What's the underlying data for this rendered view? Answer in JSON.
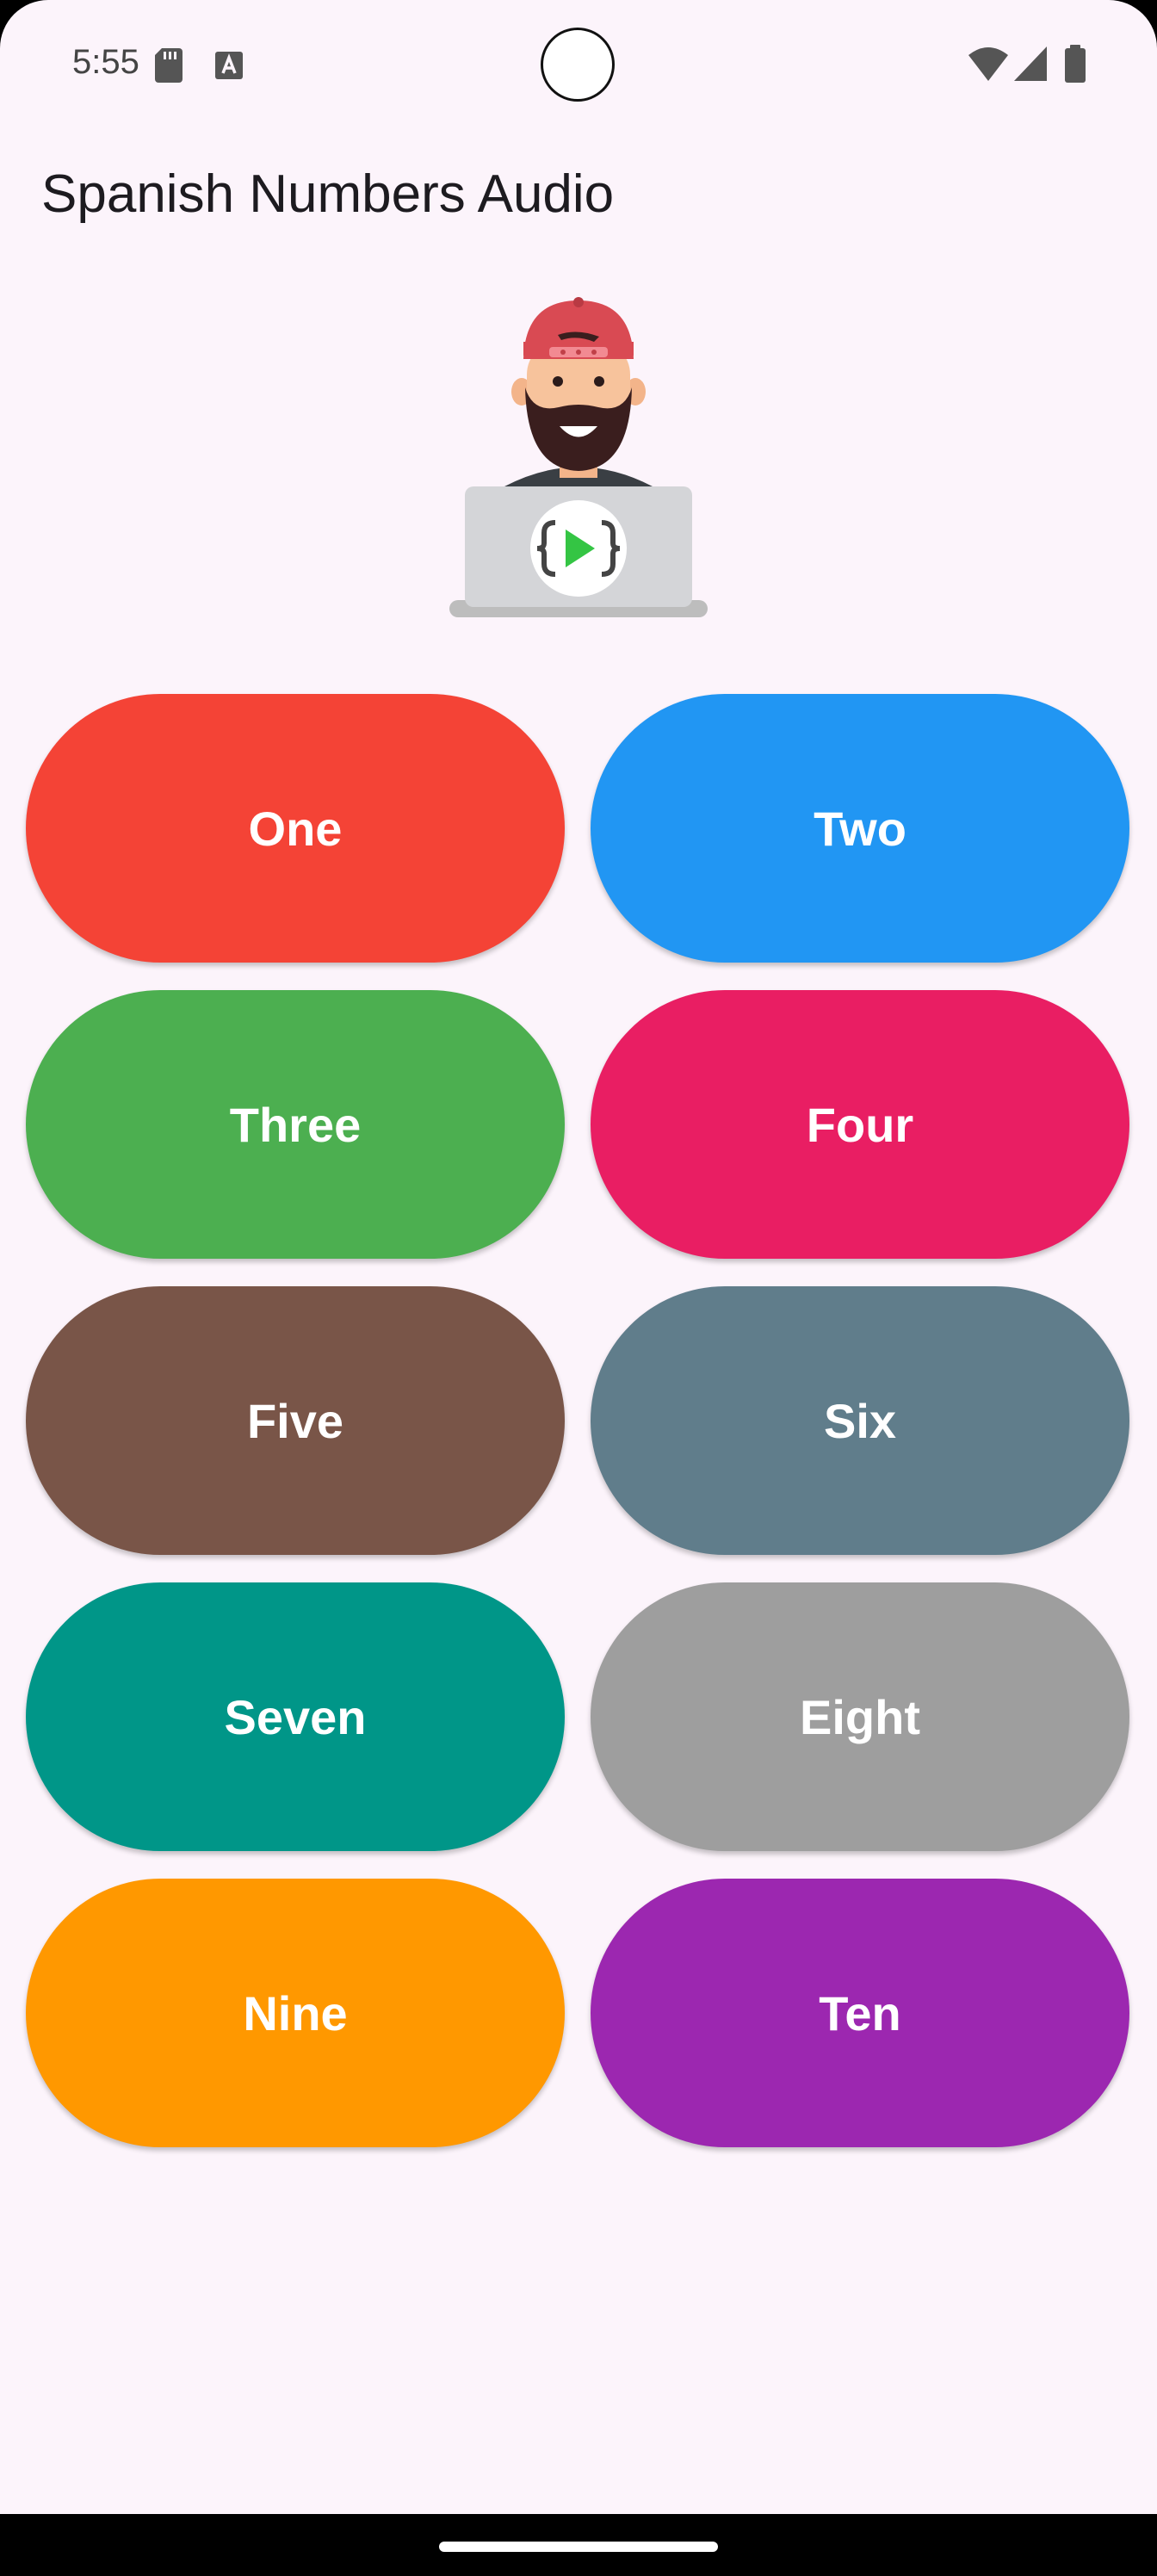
{
  "status_bar": {
    "time": "5:55",
    "icons": [
      "sd-card-icon",
      "font-a-icon",
      "wifi-icon",
      "signal-icon",
      "battery-icon"
    ]
  },
  "app": {
    "title": "Spanish Numbers Audio"
  },
  "illustration": {
    "icon": "developer-avatar-icon"
  },
  "buttons": [
    {
      "label": "One",
      "color": "#f44336"
    },
    {
      "label": "Two",
      "color": "#2196f3"
    },
    {
      "label": "Three",
      "color": "#4caf50"
    },
    {
      "label": "Four",
      "color": "#e91e63"
    },
    {
      "label": "Five",
      "color": "#795548"
    },
    {
      "label": "Six",
      "color": "#607d8b"
    },
    {
      "label": "Seven",
      "color": "#009688"
    },
    {
      "label": "Eight",
      "color": "#9e9e9e"
    },
    {
      "label": "Nine",
      "color": "#ff9800"
    },
    {
      "label": "Ten",
      "color": "#9c27b0"
    }
  ],
  "colors": {
    "background": "#fcf4fb",
    "text": "#1d1b20"
  }
}
